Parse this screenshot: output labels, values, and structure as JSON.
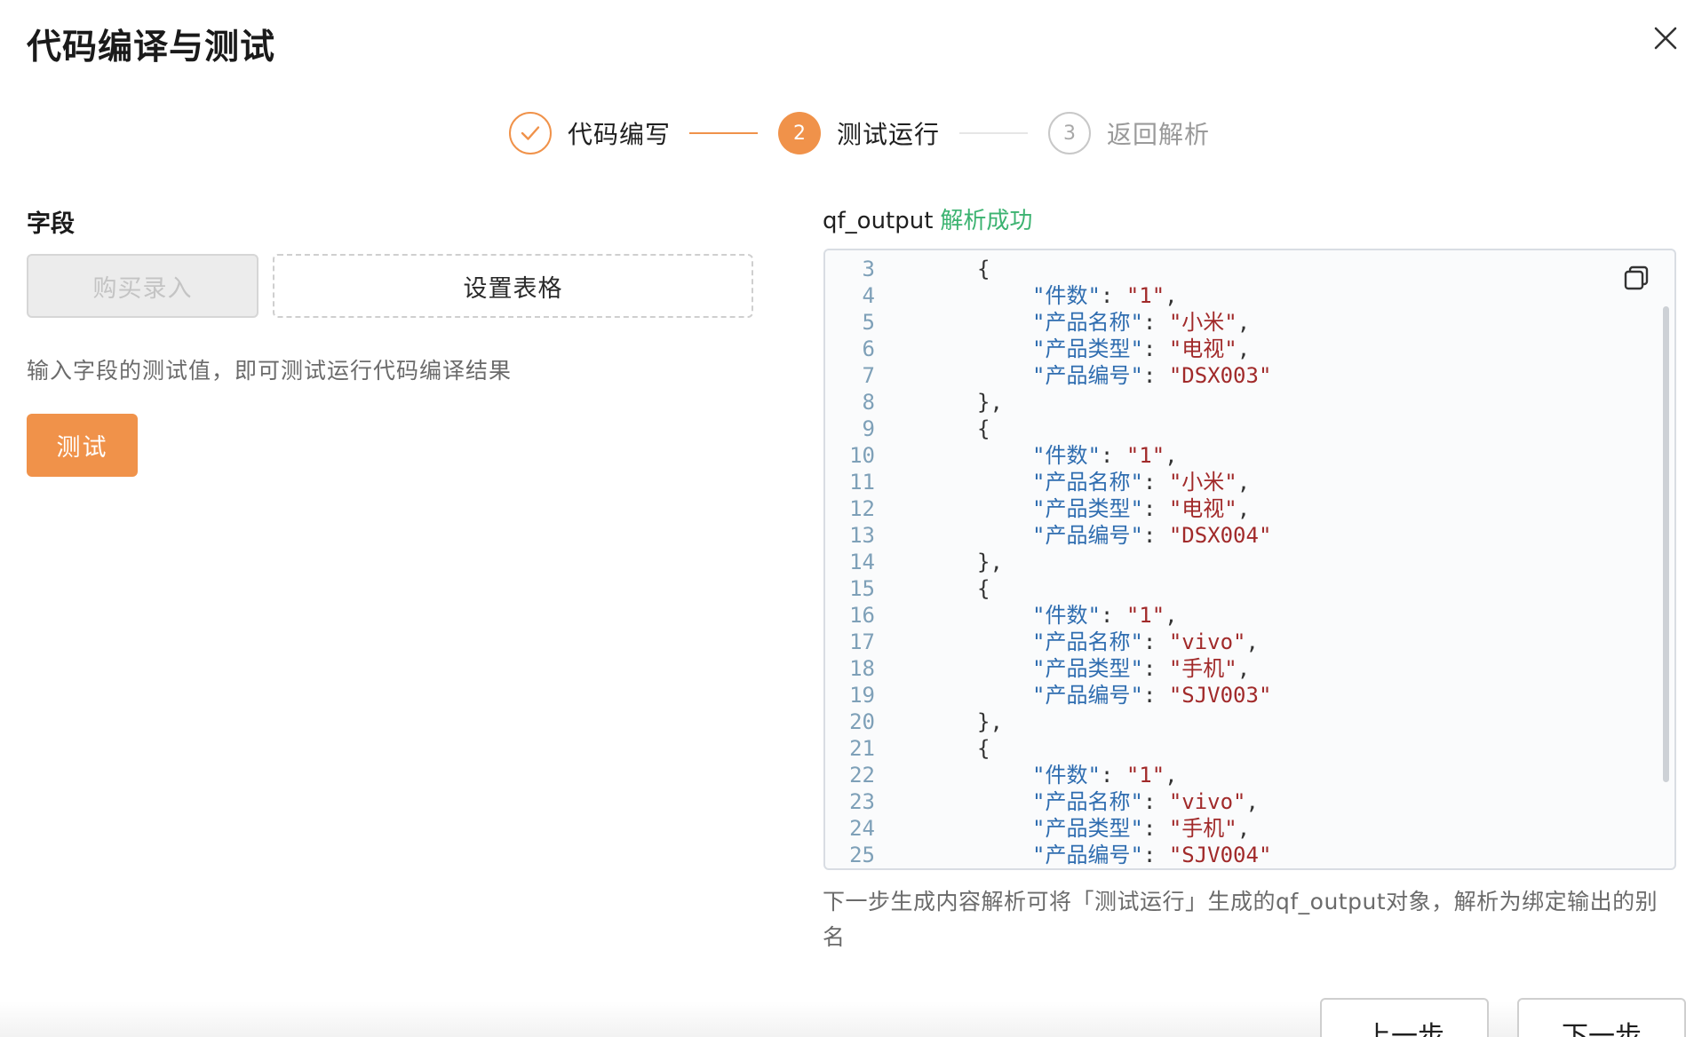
{
  "dialog": {
    "title": "代码编译与测试"
  },
  "steps": [
    {
      "label": "代码编写",
      "state": "done",
      "number": "1"
    },
    {
      "label": "测试运行",
      "state": "active",
      "number": "2"
    },
    {
      "label": "返回解析",
      "state": "pending",
      "number": "3"
    }
  ],
  "fields": {
    "label": "字段",
    "purchase_button": "购买录入",
    "set_table_button": "设置表格",
    "hint": "输入字段的测试值，即可测试运行代码编译结果",
    "test_button": "测试"
  },
  "output": {
    "name": "qf_output",
    "status": "解析成功",
    "lines": [
      {
        "n": "3",
        "indent": 1,
        "type": "open"
      },
      {
        "n": "4",
        "indent": 2,
        "key": "件数",
        "value": "1",
        "comma": true
      },
      {
        "n": "5",
        "indent": 2,
        "key": "产品名称",
        "value": "小米",
        "comma": true
      },
      {
        "n": "6",
        "indent": 2,
        "key": "产品类型",
        "value": "电视",
        "comma": true
      },
      {
        "n": "7",
        "indent": 2,
        "key": "产品编号",
        "value": "DSX003",
        "comma": false
      },
      {
        "n": "8",
        "indent": 1,
        "type": "close"
      },
      {
        "n": "9",
        "indent": 1,
        "type": "open"
      },
      {
        "n": "10",
        "indent": 2,
        "key": "件数",
        "value": "1",
        "comma": true
      },
      {
        "n": "11",
        "indent": 2,
        "key": "产品名称",
        "value": "小米",
        "comma": true
      },
      {
        "n": "12",
        "indent": 2,
        "key": "产品类型",
        "value": "电视",
        "comma": true
      },
      {
        "n": "13",
        "indent": 2,
        "key": "产品编号",
        "value": "DSX004",
        "comma": false
      },
      {
        "n": "14",
        "indent": 1,
        "type": "close"
      },
      {
        "n": "15",
        "indent": 1,
        "type": "open"
      },
      {
        "n": "16",
        "indent": 2,
        "key": "件数",
        "value": "1",
        "comma": true
      },
      {
        "n": "17",
        "indent": 2,
        "key": "产品名称",
        "value": "vivo",
        "comma": true
      },
      {
        "n": "18",
        "indent": 2,
        "key": "产品类型",
        "value": "手机",
        "comma": true
      },
      {
        "n": "19",
        "indent": 2,
        "key": "产品编号",
        "value": "SJV003",
        "comma": false
      },
      {
        "n": "20",
        "indent": 1,
        "type": "close"
      },
      {
        "n": "21",
        "indent": 1,
        "type": "open"
      },
      {
        "n": "22",
        "indent": 2,
        "key": "件数",
        "value": "1",
        "comma": true
      },
      {
        "n": "23",
        "indent": 2,
        "key": "产品名称",
        "value": "vivo",
        "comma": true
      },
      {
        "n": "24",
        "indent": 2,
        "key": "产品类型",
        "value": "手机",
        "comma": true
      },
      {
        "n": "25",
        "indent": 2,
        "key": "产品编号",
        "value": "SJV004",
        "comma": false
      }
    ],
    "hint": "下一步生成内容解析可将「测试运行」生成的qf_output对象，解析为绑定输出的别名"
  },
  "footer": {
    "prev_button": "上一步",
    "next_button": "下一步"
  },
  "colors": {
    "accent": "#f0924a",
    "success": "#3cb371",
    "code_key": "#2f6db0",
    "code_string": "#a12a2a"
  }
}
